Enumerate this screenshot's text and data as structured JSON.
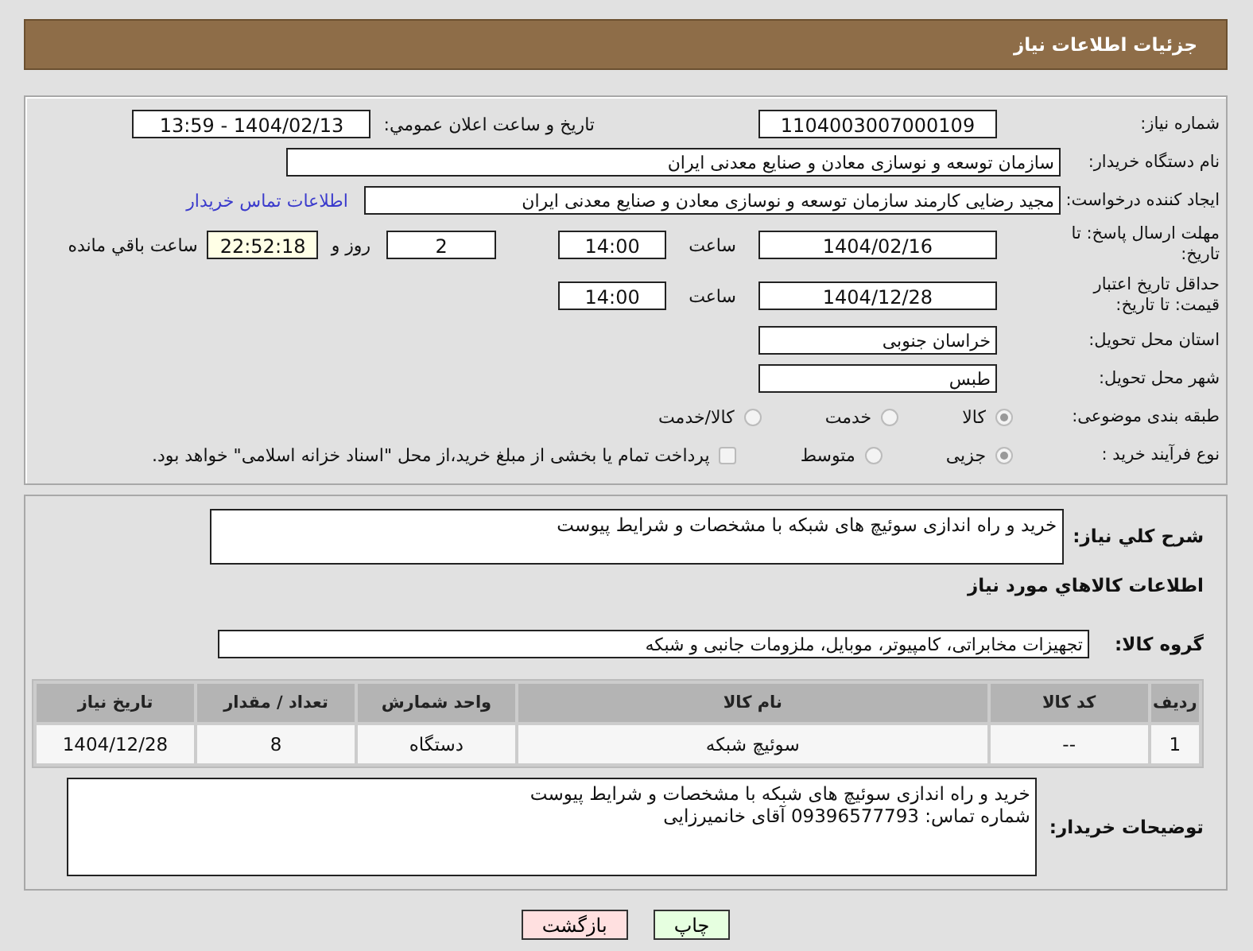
{
  "title": "جزئیات اطلاعات نیاز",
  "need_number": {
    "label": "شماره نیاز:",
    "value": "1104003007000109"
  },
  "announce": {
    "label": "تاریخ و ساعت اعلان عمومي:",
    "value": "1404/02/13 - 13:59"
  },
  "buyer_org": {
    "label": "نام دستگاه خریدار:",
    "value": "سازمان توسعه و نوسازی معادن و صنایع معدنی ایران"
  },
  "requester": {
    "label": "ایجاد کننده درخواست:",
    "value": "مجید رضایی  کارمند  سازمان توسعه و نوسازی معادن و صنایع معدنی ایران",
    "link": "اطلاعات تماس خریدار"
  },
  "reply_deadline": {
    "label": "مهلت ارسال پاسخ: تا تاریخ:",
    "date": "1404/02/16",
    "time_label": "ساعت",
    "time": "14:00",
    "days": "2",
    "days_label": "روز و",
    "remaining": "22:52:18",
    "remaining_label": "ساعت باقي مانده"
  },
  "price_validity": {
    "label": "حداقل تاریخ اعتبار قیمت: تا تاریخ:",
    "date": "1404/12/28",
    "time_label": "ساعت",
    "time": "14:00"
  },
  "province": {
    "label": "استان محل تحویل:",
    "value": "خراسان جنوبی"
  },
  "city": {
    "label": "شهر محل تحویل:",
    "value": "طبس"
  },
  "category": {
    "label": "طبقه بندی موضوعی:",
    "options": [
      {
        "label": "کالا",
        "selected": true
      },
      {
        "label": "خدمت",
        "selected": false
      },
      {
        "label": "کالا/خدمت",
        "selected": false
      }
    ]
  },
  "process": {
    "label": "نوع فرآیند خرید :",
    "options": [
      {
        "label": "جزیی",
        "selected": true
      },
      {
        "label": "متوسط",
        "selected": false
      }
    ],
    "payment": {
      "label": "پرداخت تمام یا بخشی از مبلغ خرید،از محل \"اسناد خزانه اسلامی\" خواهد بود.",
      "checked": false
    }
  },
  "description": {
    "label": "شرح کلي نیاز:",
    "value": "خرید و راه اندازی سوئیچ های شبکه با مشخصات و شرایط پیوست"
  },
  "goods_heading": "اطلاعات کالاهاي مورد نیاز",
  "goods_group": {
    "label": "گروه کالا:",
    "value": "تجهیزات مخابراتی، کامپیوتر، موبایل، ملزومات جانبی و شبکه"
  },
  "table": {
    "columns": [
      "ردیف",
      "کد کالا",
      "نام کالا",
      "واحد شمارش",
      "تعداد / مقدار",
      "تاریخ نیاز"
    ],
    "rows": [
      [
        "1",
        "--",
        "سوئیچ شبکه",
        "دستگاه",
        "8",
        "1404/12/28"
      ]
    ]
  },
  "buyer_notes": {
    "label": "توضیحات خریدار:",
    "lines": [
      "خرید و راه اندازی سوئیچ های شبکه با مشخصات و شرایط پیوست",
      "شماره تماس: 09396577793 آقای خانمیرزایی"
    ]
  },
  "buttons": [
    {
      "label": "چاپ",
      "kind": "print"
    },
    {
      "label": "بازگشت",
      "kind": "back"
    }
  ]
}
